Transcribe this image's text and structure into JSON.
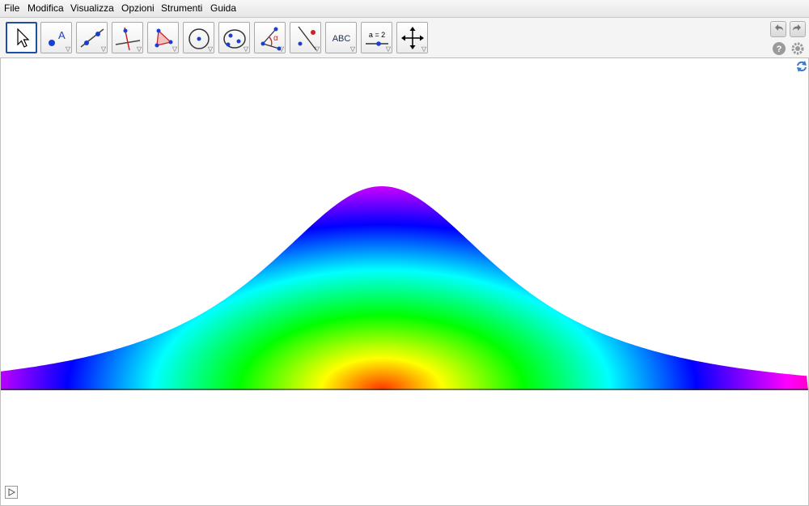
{
  "menu": {
    "items": [
      "File",
      "Modifica",
      "Visualizza",
      "Opzioni",
      "Strumenti",
      "Guida"
    ]
  },
  "toolbar": {
    "tools": [
      {
        "name": "move-tool",
        "label": ""
      },
      {
        "name": "point-tool",
        "label": "A"
      },
      {
        "name": "line-tool",
        "label": ""
      },
      {
        "name": "perpendicular-tool",
        "label": ""
      },
      {
        "name": "polygon-tool",
        "label": ""
      },
      {
        "name": "circle-tool",
        "label": ""
      },
      {
        "name": "conic-tool",
        "label": ""
      },
      {
        "name": "angle-tool",
        "label": "α"
      },
      {
        "name": "reflect-tool",
        "label": ""
      },
      {
        "name": "text-tool",
        "label": "ABC"
      },
      {
        "name": "slider-tool",
        "label": "a = 2"
      },
      {
        "name": "move-view-tool",
        "label": ""
      }
    ]
  },
  "colors": {
    "selection_border": "#1d4fa8",
    "point_blue": "#1a3fcf",
    "angle_red": "#cc2222"
  },
  "graphics": {
    "description_colors": [
      "#ff0000",
      "#ff00ff",
      "#0000ff",
      "#00ffff",
      "#00ff00",
      "#ffff00",
      "#ff8000"
    ]
  }
}
